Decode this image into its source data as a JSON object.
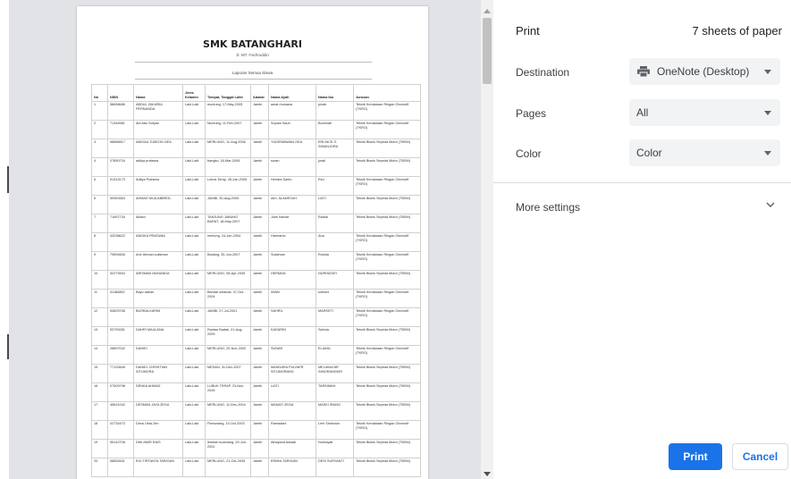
{
  "document": {
    "school": "SMK BATANGHARI",
    "address": "Jl. MT. Fachruddin",
    "report_title": "Laporan Semua Siswa",
    "columns": [
      "No",
      "NISN",
      "Nama",
      "Jenis Kelamin",
      "Tempat, Tanggal Lahir",
      "Alamat",
      "Nama Ayah",
      "Nama Ibu",
      "Jurusan"
    ],
    "rows": [
      [
        "1",
        "58658686",
        "ABDUL ZAKARIA PERNANDA",
        "Laki-Laki",
        "muntung, 17-May-2005",
        "Jambi",
        "amat munawa",
        "pinah",
        "Teknik Kendaraan Ringan Otomotif (TKRO)"
      ],
      [
        "2",
        "71345981",
        "Abi Abu Sofyan",
        "Laki-Laki",
        "Muntung, 11-Feb-2007",
        "Jambi",
        "Sopian Saun",
        "Burninah",
        "Teknik Kendaraan Ringan Otomotif (TKRO)"
      ],
      [
        "3",
        "68885817",
        "ABIGAIL GIDEON GEA",
        "Laki-Laki",
        "MERLUNG, 11-Aug-2006",
        "Jambi",
        "YUDIRMAWAN GEA",
        "ERLINCE G SIMANJORA",
        "Teknik Bisnis Sepeda Motor (TBSM)"
      ],
      [
        "4",
        "07890716",
        "aditya pratama",
        "Laki-Laki",
        "bangko, 16-Mar-2006",
        "Jambi",
        "suran",
        "jurail",
        "Teknik Bisnis Sepeda Motor (TBSM)"
      ],
      [
        "5",
        "51313173",
        "Aditya Pratama",
        "Laki-Laki",
        "Lubuk Terap, 26-Jan-2005",
        "Jambi",
        "Hendra Santo",
        "Rini",
        "Teknik Kendaraan Ringan Otomotif (TKRO)"
      ],
      [
        "6",
        "50953363",
        "AHMAD MIJA ABBROL",
        "Laki-Laki",
        "JAMBI, 30-Aug-2005",
        "Jambi",
        "Alm. ALAMSYAH",
        "LIATI",
        "Teknik Bisnis Sepeda Motor (TBSM)"
      ],
      [
        "7",
        "71657734",
        "Aldani",
        "Laki-Laki",
        "TANJUNG JABUNG BARAT, 18-May-2007",
        "Jambi",
        "Jumi hamidi",
        "Raiida",
        "Teknik Bisnis Sepeda Motor (TBSM)"
      ],
      [
        "8",
        "43238622",
        "ANDIKA PRATAMA",
        "Laki-Laki",
        "merlung, 24-Jan-2004",
        "Jambi",
        "Harmanto",
        "Ana",
        "Teknik Kendaraan Ringan Otomotif (TKRO)"
      ],
      [
        "9",
        "79894606",
        "Anir Ahmad sulaiman",
        "Laki-Laki",
        "Badang, 30-Jun-2007",
        "Jambi",
        "Sulaiman",
        "Rosida",
        "Teknik Kendaraan Ringan Otomotif (TKRO)"
      ],
      [
        "10",
        "52279454",
        "ARISMAN MUNANDA",
        "Laki-Laki",
        "MERLUNG, 08-Apr-2005",
        "Jambi",
        "HERMAN",
        "NURHAYATI",
        "Teknik Bisnis Sepeda Motor (TBSM)"
      ],
      [
        "11",
        "41180852",
        "Bayu adrian",
        "Laki-Laki",
        "Bandar selamat, 07-Oct-2004",
        "Jambi",
        "IWAN",
        "sutrioni",
        "Teknik Kendaraan Ringan Otomotif (TKRO)"
      ],
      [
        "12",
        "53829758",
        "BUSRALKARIM",
        "Laki-Laki",
        "JAMBI, 27-Jul-2001",
        "Jambi",
        "SAHRIL",
        "MARSETI",
        "Teknik Kendaraan Ringan Otomotif (TKRO)"
      ],
      [
        "13",
        "53790281",
        "DAHRI MAULANA",
        "Laki-Laki",
        "Rantau Badak, 21-Aug-2005",
        "Jambi",
        "KADARIN",
        "Sahnia",
        "Teknik Bisnis Sepeda Motor (TBSM)"
      ],
      [
        "14",
        "28897042",
        "DANIEI",
        "Laki-Laki",
        "MERLUNG, 20-Nov-2002",
        "Jambi",
        "SUNAR",
        "ELIANA",
        "Teknik Kendaraan Ringan Otomotif (TKRO)"
      ],
      [
        "15",
        "77120846",
        "DANIEL CHRISTIAN SITUMORA",
        "Laki-Laki",
        "MEDAN, 31-Dec-2007",
        "Jambi",
        "MANGARA PULINER SITUMORANG",
        "MELIANA BR SIMORANGKIR",
        "Teknik Bisnis Sepeda Motor (TBSM)"
      ],
      [
        "16",
        "07509798",
        "DENKA AHMAD",
        "Laki-Laki",
        "LUBUK TERAP, 23-Nov-2006",
        "Jambi",
        "LIATI",
        "TARSIMAH",
        "Teknik Bisnis Sepeda Motor (TBSM)"
      ],
      [
        "17",
        "45621042",
        "DESMAN JAYA ZEGA",
        "Laki-Laki",
        "MERLUNG, 11-Dec-2004",
        "Jambi",
        "MANATI ZEGA",
        "MASKI IRANG",
        "Teknik Bisnis Sepeda Motor (TBSM)"
      ],
      [
        "18",
        "02731673",
        "Dirza Okta Zen",
        "Laki-Laki",
        "Pamunang, 10-Oct-2003",
        "Jambi",
        "Ramadani",
        "Leni Simbolon",
        "Teknik Kendaraan Ringan Otomotif (TKRO)"
      ],
      [
        "19",
        "55142708",
        "DWI AMIR RAIS",
        "Laki-Laki",
        "lembah kuamang, 29-Jun-2002",
        "Jambi",
        "Alhayand Assadi",
        "Nurhayati",
        "Teknik Bisnis Sepeda Motor (TBSM)"
      ],
      [
        "20",
        "58552631",
        "EGI TIRTANTA TARIGAN",
        "Laki-Laki",
        "MERLUNG, 21-Oct-2005",
        "Jambi",
        "ERMIN TARIGAN",
        "DESI SURYANTI",
        "Teknik Bisnis Sepeda Motor (TBSM)"
      ]
    ]
  },
  "panel": {
    "title": "Print",
    "sheets": "7 sheets of paper",
    "destination_label": "Destination",
    "destination_value": "OneNote (Desktop)",
    "pages_label": "Pages",
    "pages_value": "All",
    "color_label": "Color",
    "color_value": "Color",
    "more_settings": "More settings",
    "print_button": "Print",
    "cancel_button": "Cancel"
  },
  "icons": {
    "destination": "printer-icon",
    "dropdown": "caret-down-icon",
    "more_settings": "chevron-down-icon"
  },
  "colors": {
    "accent": "#1a73e8",
    "preview_bg": "#e1e3e6",
    "select_bg": "#f1f3f4"
  }
}
